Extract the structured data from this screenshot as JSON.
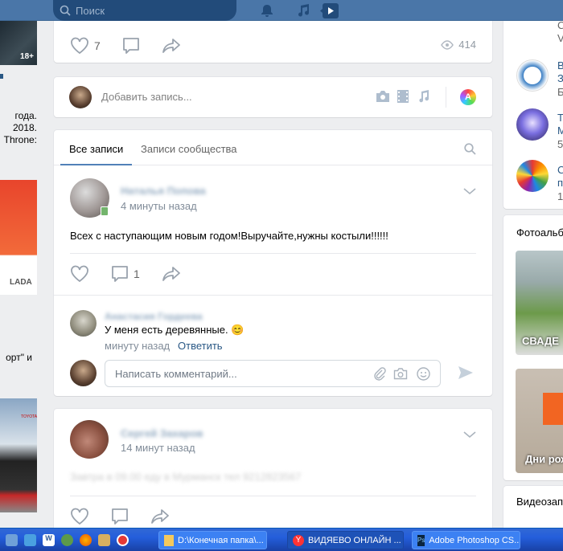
{
  "header": {
    "search_placeholder": "Поиск",
    "icons": [
      "bell-icon",
      "music-icon",
      "video-icon"
    ],
    "brand_color": "#4a76a8"
  },
  "left_column": {
    "badge": "18+",
    "texts": [
      "года.",
      "2018.",
      "Throne:",
      "орт\" и"
    ],
    "ads": [
      "LADA",
      "TOYOTA"
    ]
  },
  "top_post": {
    "likes": "7",
    "views": "414"
  },
  "composer": {
    "placeholder": "Добавить запись..."
  },
  "feed": {
    "tabs": [
      {
        "label": "Все записи",
        "active": true
      },
      {
        "label": "Записи сообщества",
        "active": false
      }
    ],
    "posts": [
      {
        "author": "Наталья Попова",
        "time": "4 минуты назад",
        "text": "Всех с наступающим новым годом!Выручайте,нужны костыли!!!!!!",
        "comments_count": "1",
        "comment": {
          "author": "Анастасия Гордеева",
          "text": "У меня есть деревянные. 😊",
          "time": "минуту назад",
          "reply": "Ответить"
        },
        "comment_placeholder": "Написать комментарий..."
      },
      {
        "author": "Сергей Захаров",
        "time": "14 минут назад",
        "text": "Завтра в 09.00 еду в Мурманск тел 9212823567"
      }
    ]
  },
  "right_column": {
    "top_letters": [
      "С",
      "V"
    ],
    "groups": [
      {
        "l1": "В",
        "l2": "З",
        "l3": "Б"
      },
      {
        "l1": "Т",
        "l2": "М",
        "l3": "5"
      },
      {
        "l1": "С",
        "l2": "п",
        "l3": "1"
      }
    ],
    "photo_albums_title": "Фотоальб",
    "albums": [
      "СВАДЕ",
      "Дни рож"
    ],
    "videos_title": "Видеозап"
  },
  "taskbar": {
    "windows": [
      {
        "label": "D:\\Конечная папка\\..."
      },
      {
        "label": "ВИДЯЕВО ОНЛАЙН ..."
      },
      {
        "label": "Adobe Photoshop CS..."
      }
    ]
  }
}
